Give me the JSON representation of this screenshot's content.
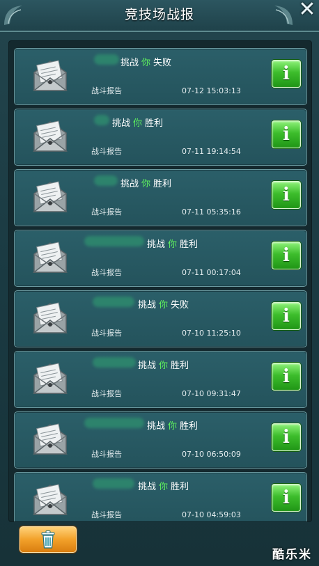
{
  "header": {
    "title": "竞技场战报"
  },
  "reports": [
    {
      "prefix": "挑战",
      "you": "你",
      "result": "失败",
      "label": "战斗报告",
      "time": "07-12 15:03:13"
    },
    {
      "prefix": "挑战",
      "you": "你",
      "result": "胜利",
      "label": "战斗报告",
      "time": "07-11 19:14:54"
    },
    {
      "prefix": "挑战",
      "you": "你",
      "result": "胜利",
      "label": "战斗报告",
      "time": "07-11 05:35:16"
    },
    {
      "prefix": "挑战",
      "you": "你",
      "result": "胜利",
      "label": "战斗报告",
      "time": "07-11 00:17:04"
    },
    {
      "prefix": "挑战",
      "you": "你",
      "result": "失败",
      "label": "战斗报告",
      "time": "07-10 11:25:10"
    },
    {
      "prefix": "挑战",
      "you": "你",
      "result": "胜利",
      "label": "战斗报告",
      "time": "07-10 09:31:47"
    },
    {
      "prefix": "挑战",
      "you": "你",
      "result": "胜利",
      "label": "战斗报告",
      "time": "07-10 06:50:09"
    },
    {
      "prefix": "挑战",
      "you": "你",
      "result": "胜利",
      "label": "战斗报告",
      "time": "07-10 04:59:03"
    }
  ],
  "info_button_label": "i",
  "watermark": "酷乐米",
  "colors": {
    "accent_green": "#5ef05e",
    "button_green": "#3dbd2c",
    "trash_orange": "#f2a12a",
    "card_teal": "#2b5f69"
  },
  "icons": {
    "close": "close-icon",
    "envelope": "envelope-icon",
    "info": "info-icon",
    "trash": "trash-icon"
  }
}
